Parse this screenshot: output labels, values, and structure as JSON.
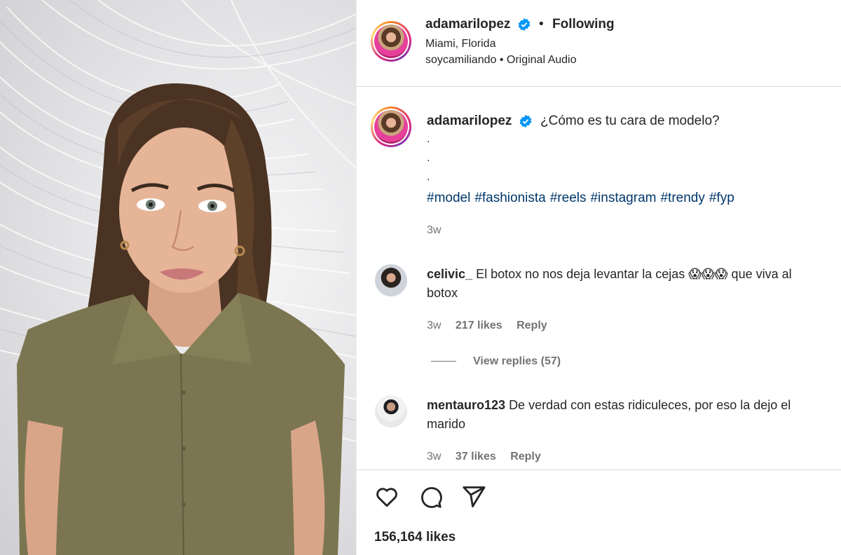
{
  "post": {
    "username": "adamarilopez",
    "follow_status": "Following",
    "separator": "•",
    "location": "Miami, Florida",
    "audio": "soycamiliando • Original Audio",
    "caption": {
      "username": "adamarilopez",
      "text": "¿Cómo es tu cara de modelo?",
      "dots": [
        ".",
        ".",
        "."
      ],
      "hashtags": [
        "#model",
        "#fashionista",
        "#reels",
        "#instagram",
        "#trendy",
        "#fyp"
      ],
      "time": "3w"
    },
    "likes": "156,164 likes"
  },
  "comments": [
    {
      "username": "celivic_",
      "text": "El botox no nos deja levantar la cejas 😱😱😱 que viva al botox",
      "time": "3w",
      "likes": "217 likes",
      "reply_label": "Reply",
      "view_replies": "View replies (57)"
    },
    {
      "username": "mentauro123",
      "text": "De verdad con estas ridiculeces, por eso la dejo el marido",
      "time": "3w",
      "likes": "37 likes",
      "reply_label": "Reply"
    }
  ],
  "icons": {
    "like": "heart-icon",
    "comment": "comment-icon",
    "share": "share-icon",
    "verified": "verified-badge-icon"
  },
  "colors": {
    "verified": "#0095f6",
    "hashtag": "#00376b",
    "muted": "#737373",
    "text": "#262626"
  }
}
